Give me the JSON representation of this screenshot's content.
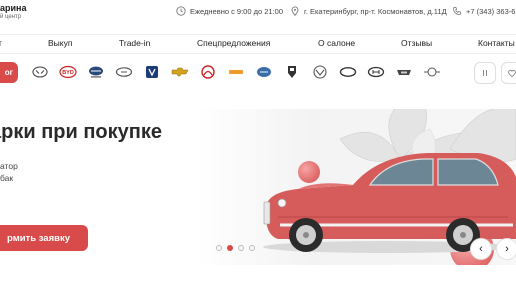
{
  "brand": {
    "title": "арина",
    "subtitle": "й центр"
  },
  "header": {
    "hours": "Ежедневно с 9:00 до 21:00",
    "address": "г. Екатеринбург, пр-т. Космонавтов, д.11Д",
    "phone": "+7 (343) 363-6"
  },
  "nav": {
    "items": [
      "т",
      "Выкуп",
      "Trade-in",
      "Спецпредложения",
      "О салоне",
      "Отзывы",
      "Контакты"
    ]
  },
  "brands_bar": {
    "pill_label": "ог",
    "logos": [
      "lifan-icon",
      "byd-icon",
      "brilliance-icon",
      "chery-icon",
      "changan-icon",
      "chevrolet-icon",
      "dongfeng-icon",
      "faw-icon",
      "geely-icon",
      "great-wall-icon",
      "hawtai-icon",
      "haval-icon",
      "hyundai-icon",
      "jac-icon",
      "jaguar-icon"
    ]
  },
  "hero": {
    "title": "арки при покупке",
    "line1": "атор",
    "line2": "бак",
    "cta_label": "рмить заявку",
    "slides_total": 4,
    "active_slide": 2
  },
  "colors": {
    "accent": "#d94a4a",
    "car": "#d65b5b"
  }
}
